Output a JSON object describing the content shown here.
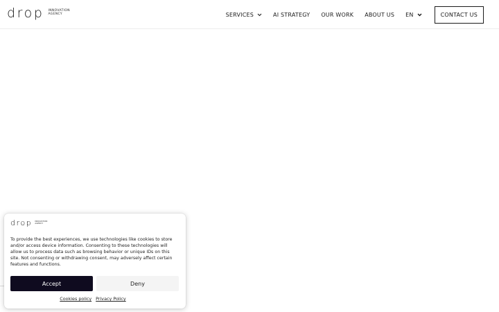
{
  "header": {
    "logo": {
      "wordmark": "drop",
      "tagline_line1": "INNOVATION",
      "tagline_line2": "AGENCY"
    },
    "nav": [
      {
        "label": "SERVICES",
        "has_dropdown": true
      },
      {
        "label": "AI STRATEGY",
        "has_dropdown": false
      },
      {
        "label": "OUR WORK",
        "has_dropdown": false
      },
      {
        "label": "ABOUT US",
        "has_dropdown": false
      },
      {
        "label": "EN",
        "has_dropdown": true
      }
    ],
    "contact_label": "CONTACT US"
  },
  "cookie_banner": {
    "logo": {
      "wordmark": "drop",
      "tagline_line1": "INNOVATION",
      "tagline_line2": "AGENCY"
    },
    "text": "To provide the best experiences, we use technologies like cookies to store and/or access device information. Consenting to these technologies will allow us to process data such as browsing behavior or unique IDs on this site. Not consenting or withdrawing consent, may adversely affect certain features and functions.",
    "accept_label": "Accept",
    "deny_label": "Deny",
    "links": {
      "cookies_policy": "Cookies policy",
      "privacy_policy": "Privacy Policy"
    }
  },
  "colors": {
    "accept_bg": "#0f0b1f",
    "deny_bg": "#f4f4f4",
    "text": "#1a1a1a",
    "border": "#1a1a1a"
  },
  "icons": {
    "dropdown": "chevron-down-icon"
  }
}
